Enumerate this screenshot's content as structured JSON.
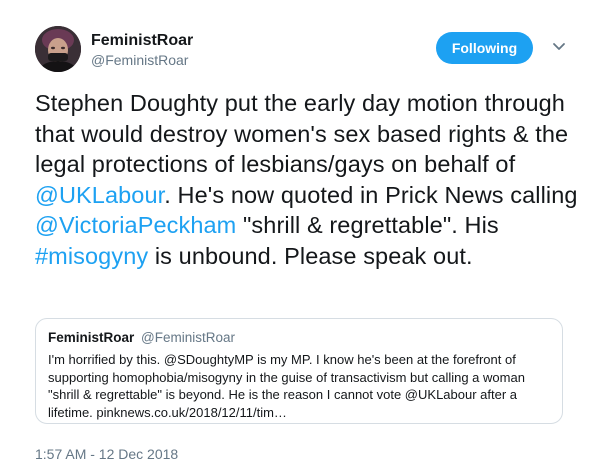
{
  "author": {
    "display_name": "FeministRoar",
    "handle": "@FeministRoar"
  },
  "follow_button": {
    "label": "Following",
    "color": "#1da1f2"
  },
  "icons": {
    "menu": "chevron-down-icon"
  },
  "tweet": {
    "segments": [
      {
        "text": "Stephen Doughty put the early day motion through that would destroy women's sex based rights & the legal protections of lesbians/gays on behalf of ",
        "type": "text"
      },
      {
        "text": "@UKLabour",
        "type": "mention"
      },
      {
        "text": ". He's now quoted in Prick News calling ",
        "type": "text"
      },
      {
        "text": "@VictoriaPeckham",
        "type": "mention"
      },
      {
        "text": " \"shrill & regrettable\". His ",
        "type": "text"
      },
      {
        "text": "#misogyny",
        "type": "hashtag"
      },
      {
        "text": " is unbound. Please speak out.",
        "type": "text"
      }
    ]
  },
  "quoted_tweet": {
    "display_name": "FeministRoar",
    "handle": "@FeministRoar",
    "text": "I'm horrified by this. @SDoughtyMP is my MP. I know he's been at the forefront of supporting homophobia/misogyny in the guise of transactivism but calling a woman \"shrill & regrettable\" is beyond. He is the reason I cannot vote @UKLabour after a lifetime. pinknews.co.uk/2018/12/11/tim…"
  },
  "timestamp": "1:57 AM - 12 Dec 2018",
  "colors": {
    "link": "#1da1f2",
    "text": "#14171a",
    "muted": "#657786",
    "border": "#d6dde3"
  }
}
